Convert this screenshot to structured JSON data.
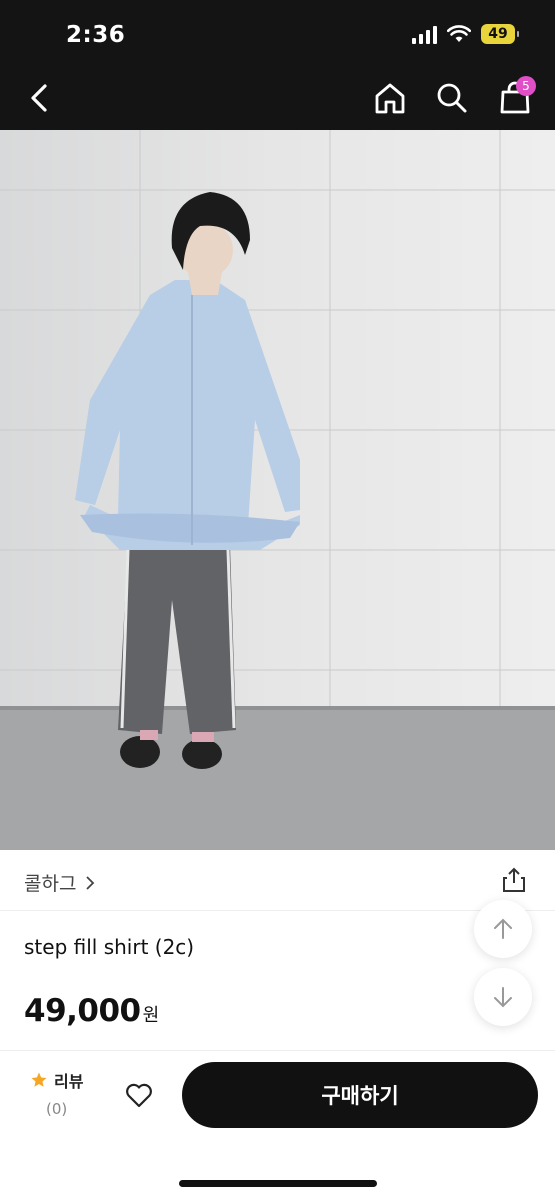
{
  "status_bar": {
    "time": "2:36",
    "battery": "49"
  },
  "header": {
    "cart_count": "5"
  },
  "product": {
    "brand": "콜하그",
    "title": "step fill shirt (2c)",
    "price": "49,000",
    "price_unit": "원"
  },
  "review": {
    "label": "리뷰",
    "count": "(0)"
  },
  "buy_button": {
    "label": "구매하기"
  },
  "colors": {
    "header_bg": "#141414",
    "badge": "#e04fc6",
    "star": "#f5a623",
    "buy_bg": "#111111"
  }
}
